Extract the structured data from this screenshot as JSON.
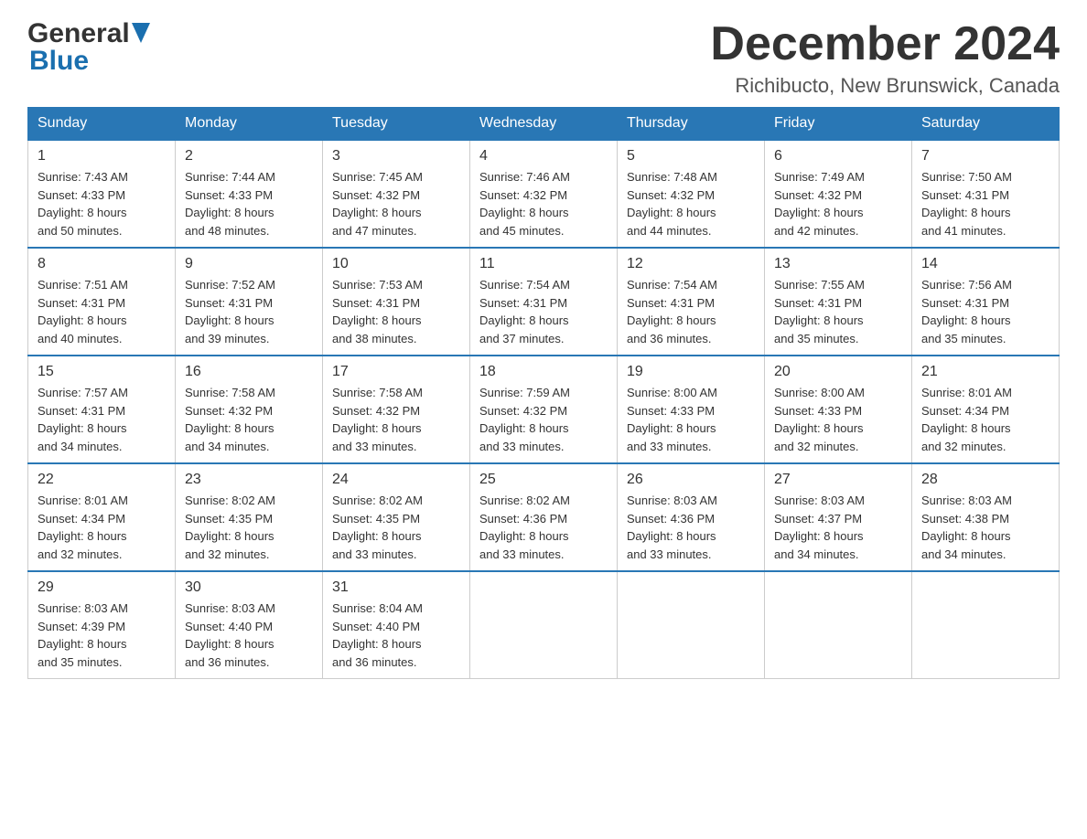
{
  "header": {
    "logo_general": "General",
    "logo_blue": "Blue",
    "month_title": "December 2024",
    "location": "Richibucto, New Brunswick, Canada"
  },
  "days_of_week": [
    "Sunday",
    "Monday",
    "Tuesday",
    "Wednesday",
    "Thursday",
    "Friday",
    "Saturday"
  ],
  "weeks": [
    [
      {
        "day": "1",
        "sunrise": "7:43 AM",
        "sunset": "4:33 PM",
        "daylight": "8 hours and 50 minutes."
      },
      {
        "day": "2",
        "sunrise": "7:44 AM",
        "sunset": "4:33 PM",
        "daylight": "8 hours and 48 minutes."
      },
      {
        "day": "3",
        "sunrise": "7:45 AM",
        "sunset": "4:32 PM",
        "daylight": "8 hours and 47 minutes."
      },
      {
        "day": "4",
        "sunrise": "7:46 AM",
        "sunset": "4:32 PM",
        "daylight": "8 hours and 45 minutes."
      },
      {
        "day": "5",
        "sunrise": "7:48 AM",
        "sunset": "4:32 PM",
        "daylight": "8 hours and 44 minutes."
      },
      {
        "day": "6",
        "sunrise": "7:49 AM",
        "sunset": "4:32 PM",
        "daylight": "8 hours and 42 minutes."
      },
      {
        "day": "7",
        "sunrise": "7:50 AM",
        "sunset": "4:31 PM",
        "daylight": "8 hours and 41 minutes."
      }
    ],
    [
      {
        "day": "8",
        "sunrise": "7:51 AM",
        "sunset": "4:31 PM",
        "daylight": "8 hours and 40 minutes."
      },
      {
        "day": "9",
        "sunrise": "7:52 AM",
        "sunset": "4:31 PM",
        "daylight": "8 hours and 39 minutes."
      },
      {
        "day": "10",
        "sunrise": "7:53 AM",
        "sunset": "4:31 PM",
        "daylight": "8 hours and 38 minutes."
      },
      {
        "day": "11",
        "sunrise": "7:54 AM",
        "sunset": "4:31 PM",
        "daylight": "8 hours and 37 minutes."
      },
      {
        "day": "12",
        "sunrise": "7:54 AM",
        "sunset": "4:31 PM",
        "daylight": "8 hours and 36 minutes."
      },
      {
        "day": "13",
        "sunrise": "7:55 AM",
        "sunset": "4:31 PM",
        "daylight": "8 hours and 35 minutes."
      },
      {
        "day": "14",
        "sunrise": "7:56 AM",
        "sunset": "4:31 PM",
        "daylight": "8 hours and 35 minutes."
      }
    ],
    [
      {
        "day": "15",
        "sunrise": "7:57 AM",
        "sunset": "4:31 PM",
        "daylight": "8 hours and 34 minutes."
      },
      {
        "day": "16",
        "sunrise": "7:58 AM",
        "sunset": "4:32 PM",
        "daylight": "8 hours and 34 minutes."
      },
      {
        "day": "17",
        "sunrise": "7:58 AM",
        "sunset": "4:32 PM",
        "daylight": "8 hours and 33 minutes."
      },
      {
        "day": "18",
        "sunrise": "7:59 AM",
        "sunset": "4:32 PM",
        "daylight": "8 hours and 33 minutes."
      },
      {
        "day": "19",
        "sunrise": "8:00 AM",
        "sunset": "4:33 PM",
        "daylight": "8 hours and 33 minutes."
      },
      {
        "day": "20",
        "sunrise": "8:00 AM",
        "sunset": "4:33 PM",
        "daylight": "8 hours and 32 minutes."
      },
      {
        "day": "21",
        "sunrise": "8:01 AM",
        "sunset": "4:34 PM",
        "daylight": "8 hours and 32 minutes."
      }
    ],
    [
      {
        "day": "22",
        "sunrise": "8:01 AM",
        "sunset": "4:34 PM",
        "daylight": "8 hours and 32 minutes."
      },
      {
        "day": "23",
        "sunrise": "8:02 AM",
        "sunset": "4:35 PM",
        "daylight": "8 hours and 32 minutes."
      },
      {
        "day": "24",
        "sunrise": "8:02 AM",
        "sunset": "4:35 PM",
        "daylight": "8 hours and 33 minutes."
      },
      {
        "day": "25",
        "sunrise": "8:02 AM",
        "sunset": "4:36 PM",
        "daylight": "8 hours and 33 minutes."
      },
      {
        "day": "26",
        "sunrise": "8:03 AM",
        "sunset": "4:36 PM",
        "daylight": "8 hours and 33 minutes."
      },
      {
        "day": "27",
        "sunrise": "8:03 AM",
        "sunset": "4:37 PM",
        "daylight": "8 hours and 34 minutes."
      },
      {
        "day": "28",
        "sunrise": "8:03 AM",
        "sunset": "4:38 PM",
        "daylight": "8 hours and 34 minutes."
      }
    ],
    [
      {
        "day": "29",
        "sunrise": "8:03 AM",
        "sunset": "4:39 PM",
        "daylight": "8 hours and 35 minutes."
      },
      {
        "day": "30",
        "sunrise": "8:03 AM",
        "sunset": "4:40 PM",
        "daylight": "8 hours and 36 minutes."
      },
      {
        "day": "31",
        "sunrise": "8:04 AM",
        "sunset": "4:40 PM",
        "daylight": "8 hours and 36 minutes."
      },
      null,
      null,
      null,
      null
    ]
  ],
  "labels": {
    "sunrise": "Sunrise:",
    "sunset": "Sunset:",
    "daylight": "Daylight:"
  }
}
